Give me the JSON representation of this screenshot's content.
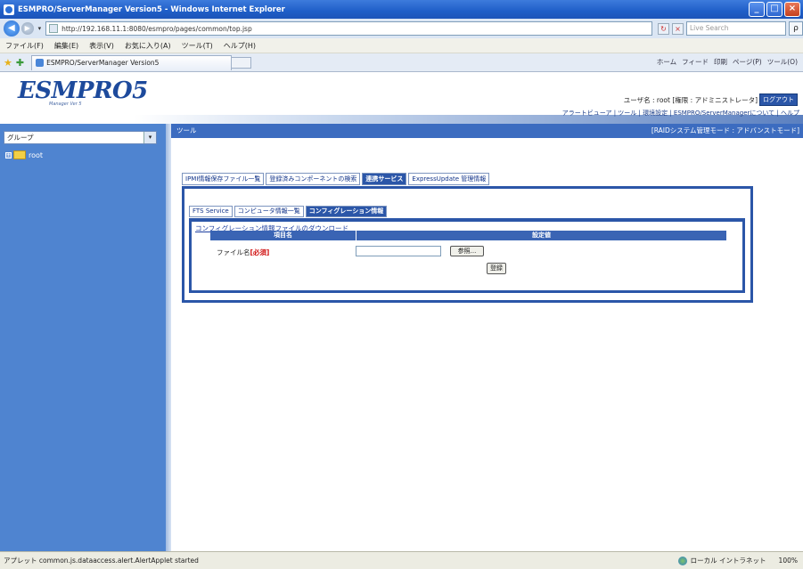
{
  "window": {
    "title": "ESMPRO/ServerManager Version5 - Windows Internet Explorer",
    "minimize": "_",
    "maximize": "□",
    "close": "×"
  },
  "addressbar": {
    "url": "http://192.168.11.1:8080/esmpro/pages/common/top.jsp",
    "search_placeholder": "Live Search",
    "back": "◀",
    "forward": "▶",
    "dropdown": "▾",
    "refresh": "↻",
    "stop": "×",
    "go": "ρ"
  },
  "menubar": {
    "items": [
      "ファイル(F)",
      "編集(E)",
      "表示(V)",
      "お気に入り(A)",
      "ツール(T)",
      "ヘルプ(H)"
    ]
  },
  "tabs": {
    "active_tab": "ESMPRO/ServerManager Version5",
    "tools": [
      "ホーム",
      "フィード",
      "印刷",
      "ページ(P)",
      "ツール(O)"
    ]
  },
  "header": {
    "logo": "ESMPRO5",
    "logo_sub": "Manager Ver 5",
    "user_line": "ユーザ名 : root [権限 : アドミニストレータ]",
    "logout": "ログアウト",
    "links": "アラートビューア | ツール | 環境設定 | ESMPRO/ServerManagerについて | ヘルプ"
  },
  "left_panel": {
    "group_select": "グループ",
    "group_arrow": "▾",
    "tree_root": "root",
    "expand": "+"
  },
  "main": {
    "bar_title": "ツール",
    "bar_right": "[RAIDシステム管理モード : アドバンストモード]",
    "outer_tabs": [
      "IPMI情報保存ファイル一覧",
      "登録済みコンポーネントの検索",
      "連携サービス",
      "ExpressUpdate 管理情報"
    ],
    "outer_active": 2,
    "inner_tabs": [
      "FTS Service",
      "コンピュータ情報一覧",
      "コンフィグレーション情報"
    ],
    "inner_active": 2,
    "download_link": "コンフィグレーション情報ファイルのダウンロード",
    "col_item": "項目名",
    "col_value": "設定値",
    "file_label": "ファイル名",
    "required": "[必須]",
    "browse": "参照...",
    "submit": "登録"
  },
  "status": {
    "text": "アプレット common.js.dataaccess.alert.AlertApplet started",
    "zone": "ローカル イントラネット",
    "zoom": "100%"
  }
}
